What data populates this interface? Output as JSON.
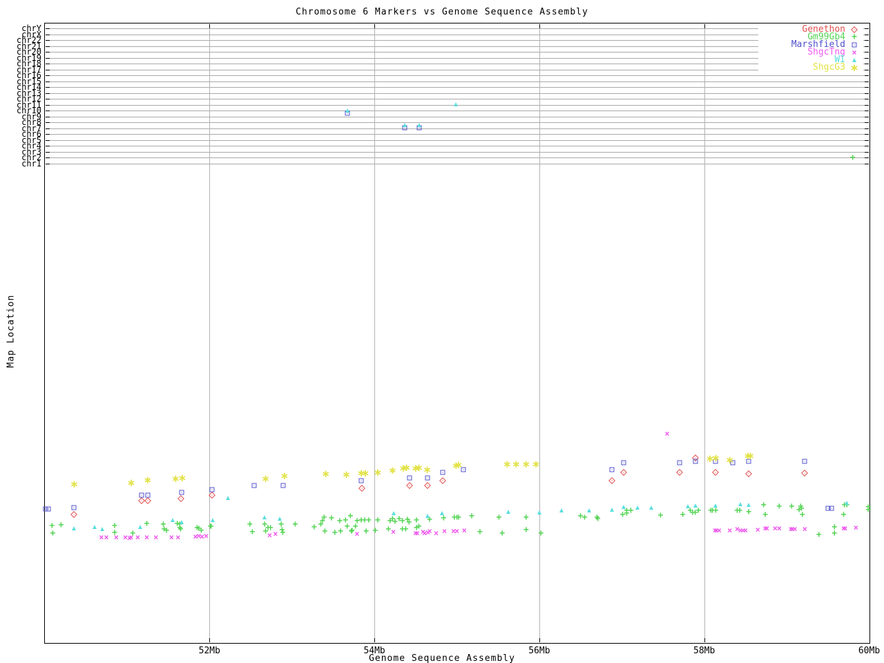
{
  "title": "Chromosome 6 Markers vs Genome Sequence Assembly",
  "axes": {
    "x_label": "Genome Sequence Assembly",
    "y_label": "Map Location",
    "x_range_mb": [
      50,
      60
    ],
    "x_ticks": [
      {
        "label": "52Mb",
        "mb": 52,
        "gridline": true
      },
      {
        "label": "54Mb",
        "mb": 54,
        "gridline": true
      },
      {
        "label": "56Mb",
        "mb": 56,
        "gridline": true
      },
      {
        "label": "58Mb",
        "mb": 58,
        "gridline": true
      },
      {
        "label": "60Mb",
        "mb": 60,
        "gridline": false
      }
    ],
    "chromosomes": [
      "chrY",
      "chrX",
      "chr22",
      "chr21",
      "chr20",
      "chr19",
      "chr18",
      "chr17",
      "chr16",
      "chr15",
      "chr14",
      "chr13",
      "chr12",
      "chr11",
      "chr10",
      "chr9",
      "chr8",
      "chr7",
      "chr6",
      "chr5",
      "chr4",
      "chr3",
      "chr2",
      "chr1"
    ]
  },
  "chart_data": {
    "type": "scatter",
    "title": "Chromosome 6 Markers vs Genome Sequence Assembly",
    "xlabel": "Genome Sequence Assembly",
    "ylabel": "Map Location",
    "x_unit": "Mb",
    "y_unit": "map location (no numeric scale shown; y stored as screen px of 960-high canvas, chromosome bands chrY..chr1 span y 41-237)",
    "xlim": [
      50,
      60
    ],
    "grid": "vertical at 52,54,56,58 Mb; horizontal per chromosome row",
    "legend_position": "top-right inside plot",
    "series": [
      {
        "name": "Genethon",
        "marker": "diamond",
        "color": "#df5050",
        "points": [
          [
            50.36,
            745
          ],
          [
            51.18,
            725
          ],
          [
            51.25,
            725
          ],
          [
            51.65,
            722
          ],
          [
            52.03,
            717
          ],
          [
            53.85,
            707
          ],
          [
            54.43,
            703
          ],
          [
            54.64,
            703
          ],
          [
            54.83,
            696
          ],
          [
            56.88,
            696
          ],
          [
            57.02,
            684
          ],
          [
            57.7,
            684
          ],
          [
            57.89,
            663
          ],
          [
            58.14,
            684
          ],
          [
            58.54,
            686
          ],
          [
            59.22,
            685
          ]
        ]
      },
      {
        "name": "Gm99Gb4",
        "marker": "plus",
        "color": "#55d455",
        "points": [
          [
            59.8,
            229
          ],
          [
            50.09,
            762
          ],
          [
            50.2,
            761
          ],
          [
            50.1,
            773
          ],
          [
            50.85,
            762
          ],
          [
            50.85,
            772
          ],
          [
            51.07,
            773
          ],
          [
            51.24,
            759
          ],
          [
            51.44,
            760
          ],
          [
            51.45,
            767
          ],
          [
            51.48,
            769
          ],
          [
            51.61,
            759
          ],
          [
            51.64,
            760
          ],
          [
            51.64,
            765
          ],
          [
            51.65,
            767
          ],
          [
            51.85,
            765
          ],
          [
            51.87,
            766
          ],
          [
            51.9,
            769
          ],
          [
            52.01,
            763
          ],
          [
            52.02,
            763
          ],
          [
            52.49,
            760
          ],
          [
            52.52,
            771
          ],
          [
            52.67,
            760
          ],
          [
            52.68,
            770
          ],
          [
            52.71,
            765
          ],
          [
            52.74,
            765
          ],
          [
            52.87,
            760
          ],
          [
            52.88,
            768
          ],
          [
            52.89,
            772
          ],
          [
            53.04,
            760
          ],
          [
            53.27,
            764
          ],
          [
            53.35,
            760
          ],
          [
            53.37,
            755
          ],
          [
            53.39,
            750
          ],
          [
            53.4,
            770
          ],
          [
            53.48,
            751
          ],
          [
            53.52,
            772
          ],
          [
            53.58,
            755
          ],
          [
            53.59,
            770
          ],
          [
            53.65,
            754
          ],
          [
            53.67,
            763
          ],
          [
            53.71,
            748
          ],
          [
            53.72,
            770
          ],
          [
            53.73,
            769
          ],
          [
            53.77,
            763
          ],
          [
            53.79,
            755
          ],
          [
            53.84,
            754
          ],
          [
            53.88,
            754
          ],
          [
            53.9,
            770
          ],
          [
            53.93,
            754
          ],
          [
            54.01,
            769
          ],
          [
            54.04,
            754
          ],
          [
            54.17,
            767
          ],
          [
            54.19,
            755
          ],
          [
            54.22,
            752
          ],
          [
            54.25,
            756
          ],
          [
            54.3,
            752
          ],
          [
            54.34,
            755
          ],
          [
            54.34,
            767
          ],
          [
            54.38,
            767
          ],
          [
            54.4,
            753
          ],
          [
            54.42,
            757
          ],
          [
            54.51,
            754
          ],
          [
            54.51,
            765
          ],
          [
            54.54,
            763
          ],
          [
            54.67,
            753
          ],
          [
            54.84,
            751
          ],
          [
            54.97,
            750
          ],
          [
            55.0,
            750
          ],
          [
            55.02,
            750
          ],
          [
            55.18,
            748
          ],
          [
            55.28,
            771
          ],
          [
            55.51,
            750
          ],
          [
            55.55,
            773
          ],
          [
            55.84,
            750
          ],
          [
            55.84,
            768
          ],
          [
            56.02,
            773
          ],
          [
            56.5,
            748
          ],
          [
            56.55,
            750
          ],
          [
            56.7,
            750
          ],
          [
            56.71,
            752
          ],
          [
            57.01,
            746
          ],
          [
            57.06,
            740
          ],
          [
            57.06,
            744
          ],
          [
            57.11,
            740
          ],
          [
            57.47,
            747
          ],
          [
            57.74,
            746
          ],
          [
            57.83,
            740
          ],
          [
            57.86,
            743
          ],
          [
            57.89,
            743
          ],
          [
            57.93,
            740
          ],
          [
            58.08,
            740
          ],
          [
            58.1,
            740
          ],
          [
            58.14,
            740
          ],
          [
            58.4,
            740
          ],
          [
            58.43,
            740
          ],
          [
            58.54,
            742
          ],
          [
            58.72,
            732
          ],
          [
            58.74,
            746
          ],
          [
            58.91,
            734
          ],
          [
            59.06,
            734
          ],
          [
            59.15,
            739
          ],
          [
            59.17,
            734
          ],
          [
            59.18,
            737
          ],
          [
            59.19,
            746
          ],
          [
            59.39,
            775
          ],
          [
            59.58,
            764
          ],
          [
            59.58,
            773
          ],
          [
            59.69,
            746
          ],
          [
            59.7,
            732
          ],
          [
            59.73,
            732
          ],
          [
            59.99,
            735
          ],
          [
            59.99,
            739
          ]
        ]
      },
      {
        "name": "Marshfield",
        "marker": "square",
        "color": "#5050cc",
        "points": [
          [
            53.67,
            164
          ],
          [
            54.37,
            185
          ],
          [
            54.54,
            185
          ],
          [
            50.01,
            737
          ],
          [
            50.05,
            737
          ],
          [
            50.36,
            735
          ],
          [
            51.18,
            717
          ],
          [
            51.25,
            717
          ],
          [
            51.66,
            713
          ],
          [
            52.03,
            709
          ],
          [
            52.54,
            703
          ],
          [
            52.89,
            703
          ],
          [
            53.84,
            696
          ],
          [
            54.43,
            692
          ],
          [
            54.64,
            692
          ],
          [
            54.83,
            684
          ],
          [
            55.08,
            680
          ],
          [
            56.88,
            680
          ],
          [
            57.02,
            670
          ],
          [
            57.7,
            670
          ],
          [
            57.89,
            668
          ],
          [
            58.14,
            668
          ],
          [
            58.35,
            670
          ],
          [
            58.54,
            668
          ],
          [
            59.22,
            668
          ],
          [
            59.5,
            736
          ],
          [
            59.54,
            736
          ]
        ]
      },
      {
        "name": "ShgcTng",
        "marker": "x",
        "color": "#ee5cee",
        "points": [
          [
            57.55,
            628
          ],
          [
            50.69,
            778
          ],
          [
            50.75,
            778
          ],
          [
            50.87,
            778
          ],
          [
            50.98,
            778
          ],
          [
            51.03,
            779
          ],
          [
            51.05,
            778
          ],
          [
            51.13,
            778
          ],
          [
            51.24,
            778
          ],
          [
            51.35,
            778
          ],
          [
            51.54,
            778
          ],
          [
            51.62,
            778
          ],
          [
            51.83,
            777
          ],
          [
            51.87,
            776
          ],
          [
            51.91,
            777
          ],
          [
            51.96,
            776
          ],
          [
            52.73,
            775
          ],
          [
            52.8,
            773
          ],
          [
            53.79,
            773
          ],
          [
            54.23,
            770
          ],
          [
            54.5,
            772
          ],
          [
            54.52,
            772
          ],
          [
            54.59,
            770
          ],
          [
            54.61,
            772
          ],
          [
            54.65,
            771
          ],
          [
            54.67,
            769
          ],
          [
            54.75,
            772
          ],
          [
            54.85,
            769
          ],
          [
            54.96,
            769
          ],
          [
            55.0,
            769
          ],
          [
            55.09,
            768
          ],
          [
            58.13,
            768
          ],
          [
            58.15,
            768
          ],
          [
            58.18,
            768
          ],
          [
            58.31,
            768
          ],
          [
            58.4,
            766
          ],
          [
            58.44,
            768
          ],
          [
            58.47,
            768
          ],
          [
            58.5,
            768
          ],
          [
            58.65,
            767
          ],
          [
            58.74,
            765
          ],
          [
            58.76,
            765
          ],
          [
            58.86,
            765
          ],
          [
            58.91,
            765
          ],
          [
            59.05,
            766
          ],
          [
            59.07,
            766
          ],
          [
            59.1,
            766
          ],
          [
            59.22,
            766
          ],
          [
            59.69,
            765
          ],
          [
            59.71,
            765
          ],
          [
            59.84,
            764
          ]
        ]
      },
      {
        "name": "WI",
        "marker": "triangle",
        "color": "#5cdede",
        "points": [
          [
            53.67,
            160
          ],
          [
            54.37,
            181
          ],
          [
            54.54,
            181
          ],
          [
            54.99,
            151
          ],
          [
            50.36,
            765
          ],
          [
            50.61,
            763
          ],
          [
            50.7,
            766
          ],
          [
            51.16,
            763
          ],
          [
            51.55,
            753
          ],
          [
            51.66,
            756
          ],
          [
            52.04,
            753
          ],
          [
            52.22,
            721
          ],
          [
            52.67,
            749
          ],
          [
            52.85,
            751
          ],
          [
            54.23,
            743
          ],
          [
            54.64,
            747
          ],
          [
            54.82,
            743
          ],
          [
            55.62,
            741
          ],
          [
            56.0,
            742
          ],
          [
            56.27,
            739
          ],
          [
            56.6,
            739
          ],
          [
            56.88,
            738
          ],
          [
            57.02,
            734
          ],
          [
            57.19,
            735
          ],
          [
            57.36,
            735
          ],
          [
            57.8,
            733
          ],
          [
            57.89,
            732
          ],
          [
            58.14,
            732
          ],
          [
            58.44,
            730
          ],
          [
            58.54,
            731
          ],
          [
            59.73,
            728
          ]
        ]
      },
      {
        "name": "ShgcG3",
        "marker": "star",
        "color": "#e2e24a",
        "points": [
          [
            50.36,
            701
          ],
          [
            51.05,
            699
          ],
          [
            51.25,
            695
          ],
          [
            51.59,
            693
          ],
          [
            51.67,
            692
          ],
          [
            52.68,
            693
          ],
          [
            52.91,
            689
          ],
          [
            53.41,
            686
          ],
          [
            53.66,
            687
          ],
          [
            53.84,
            685
          ],
          [
            53.89,
            685
          ],
          [
            54.04,
            684
          ],
          [
            54.22,
            681
          ],
          [
            54.35,
            678
          ],
          [
            54.39,
            677
          ],
          [
            54.5,
            678
          ],
          [
            54.54,
            677
          ],
          [
            54.64,
            680
          ],
          [
            54.99,
            674
          ],
          [
            55.02,
            673
          ],
          [
            55.61,
            672
          ],
          [
            55.72,
            672
          ],
          [
            55.84,
            672
          ],
          [
            55.96,
            672
          ],
          [
            58.07,
            664
          ],
          [
            58.14,
            663
          ],
          [
            58.31,
            666
          ],
          [
            58.53,
            660
          ],
          [
            58.56,
            660
          ]
        ]
      }
    ]
  }
}
